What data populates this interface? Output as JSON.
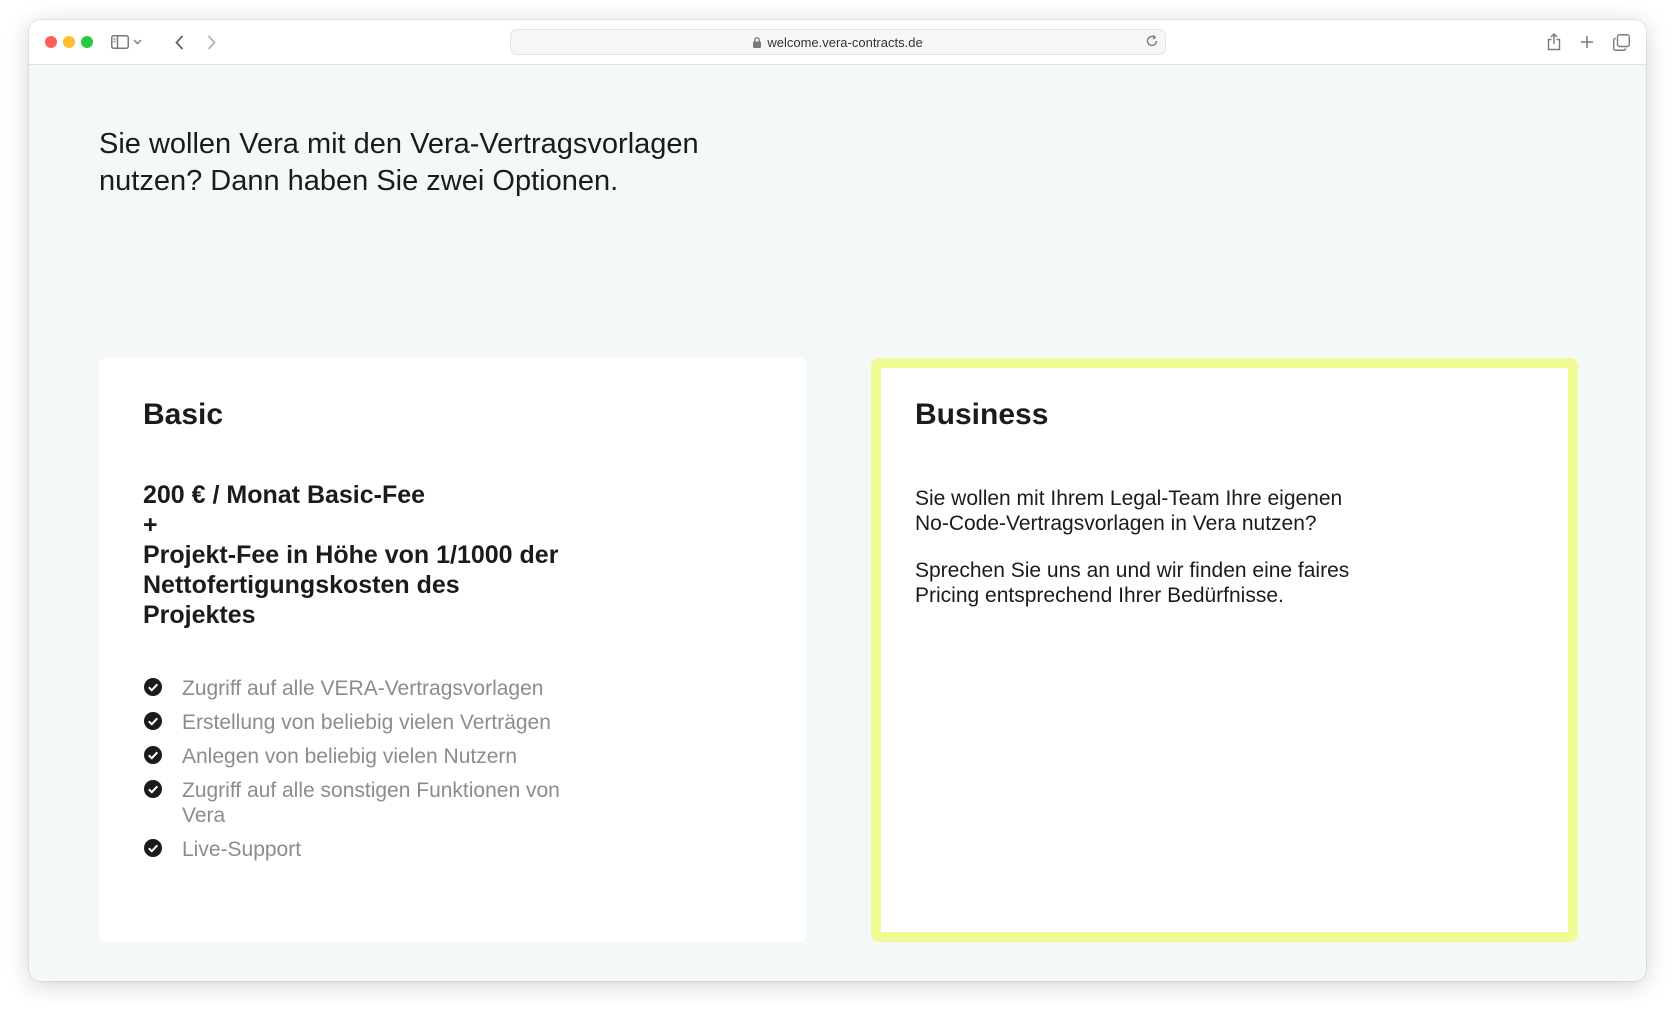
{
  "browser": {
    "url": "welcome.vera-contracts.de"
  },
  "page": {
    "headline_line1": "Sie wollen Vera mit den Vera-Vertragsvorlagen",
    "headline_line2": "nutzen? Dann haben Sie zwei Optionen."
  },
  "basic": {
    "title": "Basic",
    "price_line1": "200 € / Monat Basic-Fee",
    "price_line2": "+",
    "price_line3": "Projekt-Fee in Höhe von 1/1000 der Nettofertigungskosten des Projektes",
    "features": [
      "Zugriff auf alle VERA-Vertragsvorlagen",
      "Erstellung von beliebig vielen Verträgen",
      "Anlegen von beliebig vielen Nutzern",
      "Zugriff auf alle sonstigen Funktionen von Vera",
      "Live-Support"
    ]
  },
  "business": {
    "title": "Business",
    "paragraph1": "Sie wollen mit Ihrem Legal-Team Ihre eigenen No-Code-Vertragsvorlagen in Vera nutzen?",
    "paragraph2": "Sprechen Sie uns an und wir finden eine faires Pricing entsprechend Ihrer Bedürfnisse.",
    "border_color": "#f1fb93"
  },
  "icons": {
    "feature": "check-circle-icon",
    "toolbar": [
      "sidebar-icon",
      "chevron-down-icon",
      "back-arrow-icon",
      "forward-arrow-icon",
      "lock-icon",
      "reload-icon",
      "share-icon",
      "plus-icon",
      "tabs-overview-icon"
    ]
  }
}
